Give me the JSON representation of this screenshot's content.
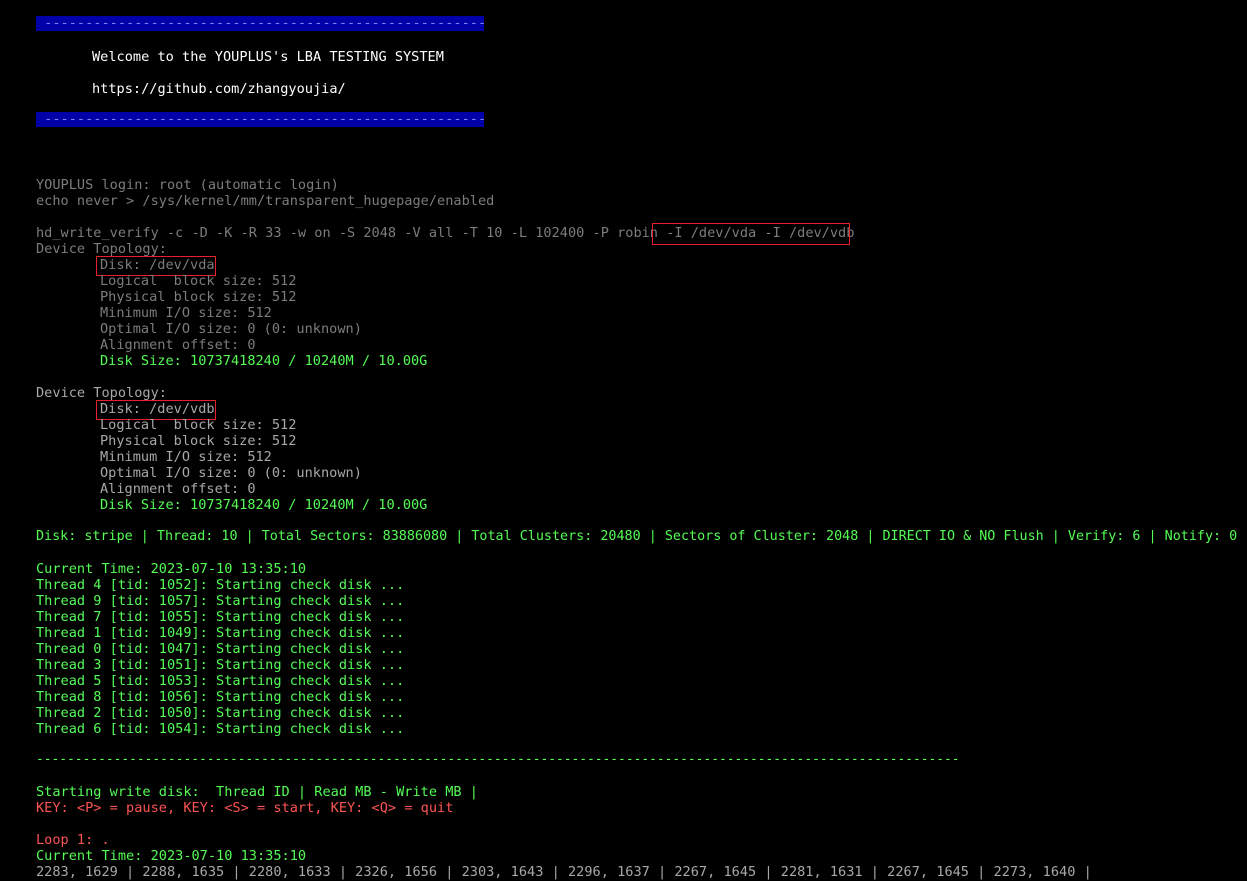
{
  "banner": {
    "bar_text": " ------------------------------------------------------",
    "welcome": "Welcome to the YOUPLUS's LBA TESTING SYSTEM",
    "url": "https://github.com/zhangyoujia/"
  },
  "login": {
    "login_line": "YOUPLUS login: root (automatic login)",
    "echo_line": "echo never > /sys/kernel/mm/transparent_hugepage/enabled"
  },
  "command": {
    "prefix": "hd_write_verify -c -D -K -R 33 -w on -S 2048 -V all -T 10 -L 102400 -P robin ",
    "devices": "-I /dev/vda -I /dev/vdb"
  },
  "topology": [
    {
      "header": "Device Topology:",
      "disk": "Disk: /dev/vda",
      "logical": "Logical  block size: 512",
      "physical": "Physical block size: 512",
      "min_io": "Minimum I/O size: 512",
      "opt_io": "Optimal I/O size: 0 (0: unknown)",
      "align": "Alignment offset: 0",
      "size": "Disk Size: 10737418240 / 10240M / 10.00G"
    },
    {
      "header": "Device Topology:",
      "disk": "Disk: /dev/vdb",
      "logical": "Logical  block size: 512",
      "physical": "Physical block size: 512",
      "min_io": "Minimum I/O size: 512",
      "opt_io": "Optimal I/O size: 0 (0: unknown)",
      "align": "Alignment offset: 0",
      "size": "Disk Size: 10737418240 / 10240M / 10.00G"
    }
  ],
  "summary": "Disk: stripe | Thread: 10 | Total Sectors: 83886080 | Total Clusters: 20480 | Sectors of Cluster: 2048 | DIRECT IO & NO Flush | Verify: 6 | Notify: 0",
  "current_time_1": "Current Time: 2023-07-10 13:35:10",
  "threads": [
    "Thread 4 [tid: 1052]: Starting check disk ...",
    "Thread 9 [tid: 1057]: Starting check disk ...",
    "Thread 7 [tid: 1055]: Starting check disk ...",
    "Thread 1 [tid: 1049]: Starting check disk ...",
    "Thread 0 [tid: 1047]: Starting check disk ...",
    "Thread 3 [tid: 1051]: Starting check disk ...",
    "Thread 5 [tid: 1053]: Starting check disk ...",
    "Thread 8 [tid: 1056]: Starting check disk ...",
    "Thread 2 [tid: 1050]: Starting check disk ...",
    "Thread 6 [tid: 1054]: Starting check disk ..."
  ],
  "separator": "-----------------------------------------------------------------------------------------------------------------------",
  "write_header": "Starting write disk:  Thread ID | Read MB - Write MB |",
  "keys": "KEY: <P> = pause, KEY: <S> = start, KEY: <Q> = quit",
  "loop": "Loop 1: .",
  "current_time_2": "Current Time: 2023-07-10 13:35:10",
  "throughput": "2283, 1629 | 2288, 1635 | 2280, 1633 | 2326, 1656 | 2303, 1643 | 2296, 1637 | 2267, 1645 | 2281, 1631 | 2267, 1645 | 2273, 1640 |",
  "colors": {
    "background": "#000000",
    "banner_bar": "#0000a8",
    "green": "#54fc54",
    "red": "#fc5454",
    "highlight_box": "#e8202a"
  }
}
